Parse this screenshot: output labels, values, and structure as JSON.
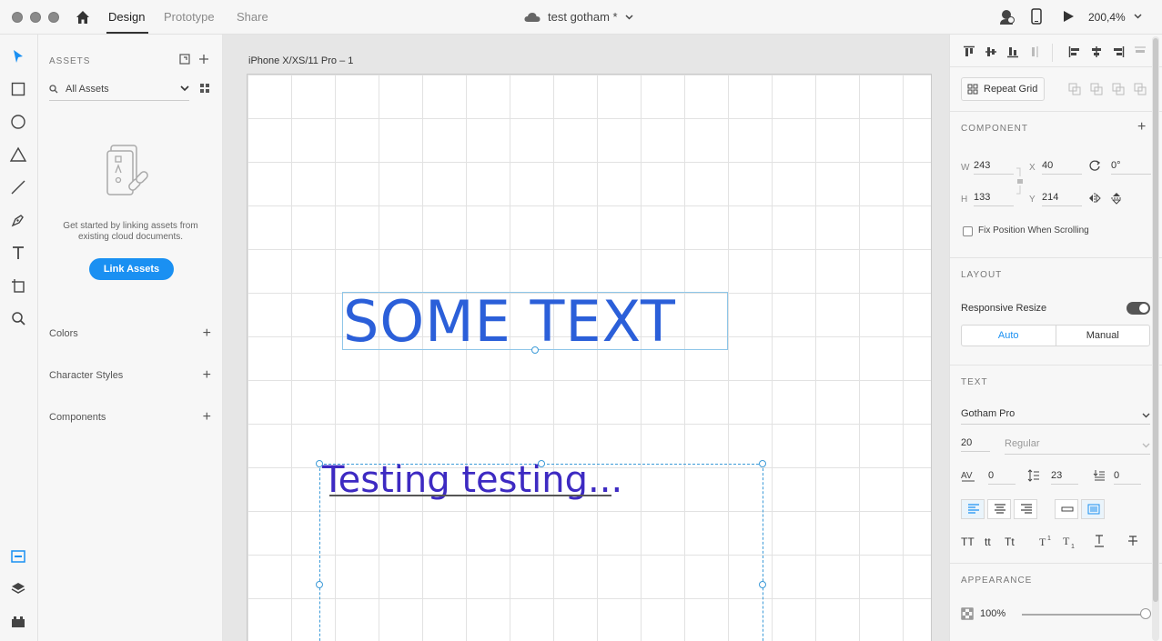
{
  "titlebar": {
    "tabs": [
      {
        "label": "Design",
        "active": true
      },
      {
        "label": "Prototype",
        "active": false
      },
      {
        "label": "Share",
        "active": false
      }
    ],
    "document_title": "test gotham *",
    "zoom": "200,4%"
  },
  "toolbar": {
    "tools": [
      "select-tool",
      "rectangle-tool",
      "ellipse-tool",
      "polygon-tool",
      "line-tool",
      "pen-tool",
      "text-tool",
      "artboard-tool",
      "zoom-tool"
    ],
    "bottom": [
      "assets-panel",
      "layers-panel",
      "plugins-panel"
    ]
  },
  "assets": {
    "title": "ASSETS",
    "filter_label": "All Assets",
    "empty_text": "Get started by linking assets from existing cloud documents.",
    "link_button": "Link Assets",
    "sections": [
      "Colors",
      "Character Styles",
      "Components"
    ]
  },
  "canvas": {
    "artboard_name": "iPhone X/XS/11 Pro – 1",
    "text1": "SOME TEXT",
    "text2": "Testing testing..."
  },
  "props": {
    "repeat_grid": "Repeat Grid",
    "component_label": "COMPONENT",
    "w_label": "W",
    "w": "243",
    "h_label": "H",
    "h": "133",
    "x_label": "X",
    "x": "40",
    "y_label": "Y",
    "y": "214",
    "rotation": "0°",
    "fix_position": "Fix Position When Scrolling",
    "layout_label": "LAYOUT",
    "responsive_resize": "Responsive Resize",
    "responsive_on": true,
    "seg_auto": "Auto",
    "seg_manual": "Manual",
    "text_label": "TEXT",
    "font_family": "Gotham Pro",
    "font_size": "20",
    "font_weight": "Regular",
    "char_spacing": "0",
    "line_spacing": "23",
    "para_spacing": "0",
    "text_styles": [
      "TT",
      "tt",
      "Tt"
    ],
    "appearance_label": "APPEARANCE",
    "opacity": "100%"
  },
  "colors": {
    "accent": "#1a90f2",
    "text1": "#2b5fd9",
    "text2": "#3d2ac2",
    "selection": "#3d9bd8"
  }
}
